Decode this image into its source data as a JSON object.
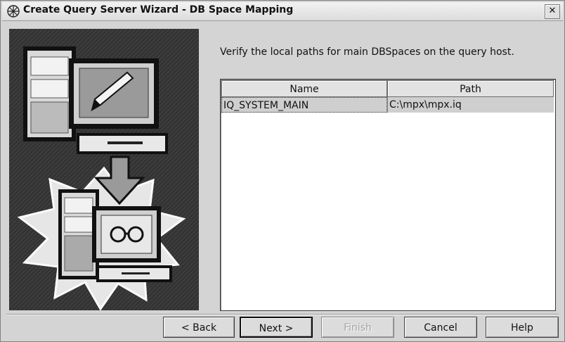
{
  "window": {
    "title": "Create  Query Server Wizard - DB Space Mapping",
    "app_icon": "wizard-star-icon",
    "close_label": "✕"
  },
  "illustration": {
    "name": "copy-server-illustration",
    "description_icons": [
      "server-icon",
      "monitor-pencil-icon",
      "arrow-down-icon",
      "server-icon",
      "monitor-glasses-icon"
    ]
  },
  "main": {
    "instruction": "Verify the local paths for main DBSpaces on the query host."
  },
  "table": {
    "columns": [
      "Name",
      "Path"
    ],
    "rows": [
      {
        "name": "IQ_SYSTEM_MAIN",
        "path": "C:\\mpx\\mpx.iq"
      }
    ]
  },
  "buttons": {
    "back": "< Back",
    "next": "Next >",
    "finish": "Finish",
    "cancel": "Cancel",
    "help": "Help"
  },
  "colors": {
    "dialog_bg": "#d4d4d4",
    "selected_row": "#cfcfcf",
    "disabled_text": "#a3a3a3"
  }
}
